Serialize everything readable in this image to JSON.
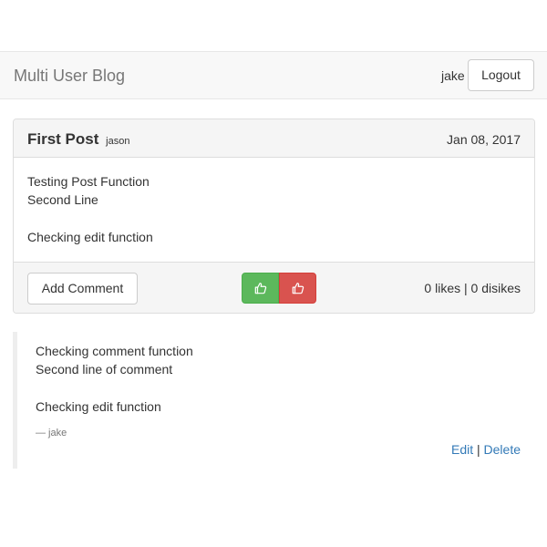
{
  "navbar": {
    "brand": "Multi User Blog",
    "username": "jake",
    "logout_label": "Logout"
  },
  "post": {
    "title": "First Post",
    "author": "jason",
    "date": "Jan 08, 2017",
    "content": {
      "line1": "Testing Post Function",
      "line2": "Second Line",
      "line3": "Checking edit function"
    },
    "add_comment_label": "Add Comment",
    "like_icon": "thumbs-up-icon",
    "dislike_icon": "thumbs-up-icon",
    "likes_summary": "0 likes | 0 disikes",
    "colors": {
      "like": "#5cb85c",
      "dislike": "#d9534f"
    }
  },
  "comment": {
    "content": {
      "line1": "Checking comment function",
      "line2": "Second line of comment",
      "line3": "Checking edit function"
    },
    "byline": "— jake",
    "edit_label": "Edit",
    "separator": "|",
    "delete_label": "Delete",
    "colors": {
      "link": "#337ab7"
    }
  }
}
